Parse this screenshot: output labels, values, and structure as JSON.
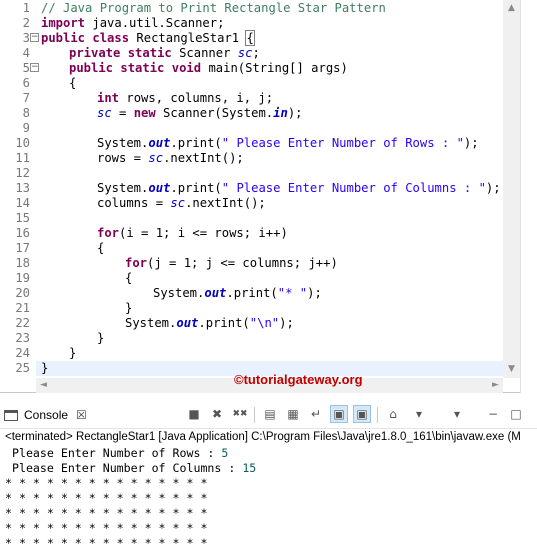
{
  "editor": {
    "line_numbers": [
      "1",
      "2",
      "3",
      "4",
      "5",
      "6",
      "7",
      "8",
      "9",
      "10",
      "11",
      "12",
      "13",
      "14",
      "15",
      "16",
      "17",
      "18",
      "19",
      "20",
      "21",
      "22",
      "23",
      "24",
      "25"
    ],
    "code": {
      "l1": "// Java Program to Print Rectangle Star Pattern",
      "l2_kw": "import",
      "l2_rest": " java.util.Scanner;",
      "l3_kw1": "public",
      "l3_kw2": "class",
      "l3_name": " RectangleStar1 ",
      "l3_brace": "{",
      "l4_kw1": "private",
      "l4_kw2": "static",
      "l4_type": " Scanner ",
      "l4_field": "sc",
      "l4_end": ";",
      "l5_kw1": "public",
      "l5_kw2": "static",
      "l5_kw3": "void",
      "l5_rest": " main(String[] args)",
      "l6": "{",
      "l7_kw": "int",
      "l7_rest": " rows, columns, i, j;",
      "l8_field": "sc",
      "l8_mid": " = ",
      "l8_kw": "new",
      "l8_rest1": " Scanner(System.",
      "l8_in": "in",
      "l8_rest2": ");",
      "l10_a": "System.",
      "l10_out": "out",
      "l10_b": ".print(",
      "l10_str": "\" Please Enter Number of Rows : \"",
      "l10_c": ");",
      "l11_a": "rows = ",
      "l11_sc": "sc",
      "l11_b": ".nextInt();",
      "l13_a": "System.",
      "l13_out": "out",
      "l13_b": ".print(",
      "l13_str": "\" Please Enter Number of Columns : \"",
      "l13_c": ");",
      "l14_a": "columns = ",
      "l14_sc": "sc",
      "l14_b": ".nextInt();",
      "l16_kw": "for",
      "l16_rest": "(i = 1; i <= rows; i++)",
      "l17": "{",
      "l18_kw": "for",
      "l18_rest": "(j = 1; j <= columns; j++)",
      "l19": "{",
      "l20_a": "System.",
      "l20_out": "out",
      "l20_b": ".print(",
      "l20_str": "\"* \"",
      "l20_c": ");",
      "l21": "}",
      "l22_a": "System.",
      "l22_out": "out",
      "l22_b": ".print(",
      "l22_str": "\"\\n\"",
      "l22_c": ");",
      "l23": "}",
      "l24": "}",
      "l25": "}"
    },
    "fold_markers": {
      "l3": "−",
      "l5": "−"
    },
    "scroll_up": "▲",
    "scroll_down": "▼",
    "scroll_left": "◄",
    "scroll_right": "►"
  },
  "watermark": "©tutorialgateway.org",
  "console": {
    "tab_label": "Console",
    "tab_close": "☒",
    "toolbar_icons": [
      "stop-square-icon",
      "remove-launch-icon",
      "remove-all-terminated-icon",
      "clear-console-icon",
      "scroll-lock-icon",
      "word-wrap-icon",
      "show-on-stdout-icon",
      "show-on-stderr-icon",
      "pin-console-icon",
      "display-selected-console-icon",
      "open-console-icon",
      "minimize-icon",
      "maximize-icon"
    ],
    "toolbar_glyphs": [
      "■",
      "✖",
      "✖✖",
      "▤",
      "▦",
      "↵",
      "▣",
      "▣",
      "⌂",
      "▾",
      "▾",
      "−",
      "□"
    ],
    "terminated": "<terminated> RectangleStar1 [Java Application] C:\\Program Files\\Java\\jre1.8.0_161\\bin\\javaw.exe (M",
    "prompt_rows": " Please Enter Number of Rows : ",
    "input_rows": "5",
    "prompt_cols": " Please Enter Number of Columns : ",
    "input_cols": "15",
    "star_rows": [
      "* * * * * * * * * * * * * * * ",
      "* * * * * * * * * * * * * * * ",
      "* * * * * * * * * * * * * * * ",
      "* * * * * * * * * * * * * * * ",
      "* * * * * * * * * * * * * * * "
    ]
  }
}
